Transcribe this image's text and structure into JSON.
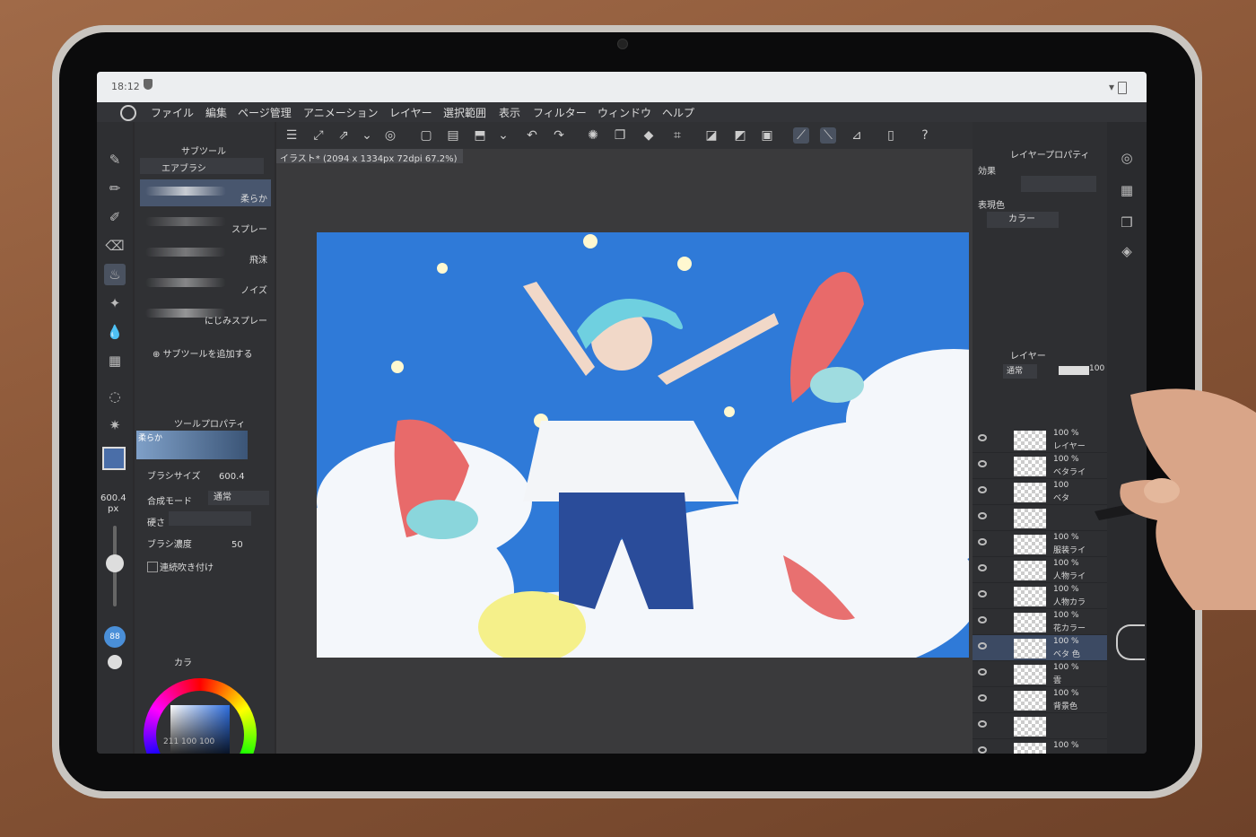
{
  "status": {
    "time": "18:12"
  },
  "menu": [
    "ファイル",
    "編集",
    "ページ管理",
    "アニメーション",
    "レイヤー",
    "選択範囲",
    "表示",
    "フィルター",
    "ウィンドウ",
    "ヘルプ"
  ],
  "document_tab": "イラスト* (2094 x 1334px 72dpi 67.2%)",
  "subtool": {
    "panel_title": "サブツール",
    "group": "エアブラシ",
    "brushes": [
      "柔らか",
      "スプレー",
      "飛沫",
      "ノイズ",
      "にじみスプレー"
    ],
    "add_label": "サブツールを追加する"
  },
  "tool_property": {
    "title": "ツールプロパティ",
    "preset_name": "柔らか",
    "brush_size_label": "ブラシサイズ",
    "brush_size_value": "600.4",
    "blend_mode_label": "合成モード",
    "blend_mode_value": "通常",
    "hardness_label": "硬さ",
    "density_label": "ブラシ濃度",
    "density_value": "50",
    "continuous_label": "連続吹き付け"
  },
  "size_indicator": {
    "value": "600.4",
    "unit": "px"
  },
  "opacity_badge": "88",
  "color_panel": {
    "title": "カラ",
    "readout": "211 100 100"
  },
  "layer_property": {
    "title": "レイヤープロパティ",
    "effect_label": "効果",
    "expression_label": "表現色",
    "expression_value": "カラー"
  },
  "layer_panel": {
    "title": "レイヤー",
    "blend": "通常",
    "opacity": "100",
    "layers": [
      {
        "opacity": "100 %",
        "name": "レイヤー"
      },
      {
        "opacity": "100 %",
        "name": "ベタライ"
      },
      {
        "opacity": "100",
        "name": "ベタ"
      },
      {
        "opacity": "",
        "name": ""
      },
      {
        "opacity": "100 %",
        "name": "服装ライ"
      },
      {
        "opacity": "100 %",
        "name": "人物ライ"
      },
      {
        "opacity": "100 %",
        "name": "人物カラ"
      },
      {
        "opacity": "100 %",
        "name": "花カラー"
      },
      {
        "opacity": "100 %",
        "name": "ベタ 色"
      },
      {
        "opacity": "100 %",
        "name": "雲"
      },
      {
        "opacity": "100 %",
        "name": "背景色"
      },
      {
        "opacity": "",
        "name": ""
      },
      {
        "opacity": "100 %",
        "name": ""
      }
    ]
  },
  "colors": {
    "accent": "#4a6ea8",
    "sky": "#2f7ad8"
  }
}
